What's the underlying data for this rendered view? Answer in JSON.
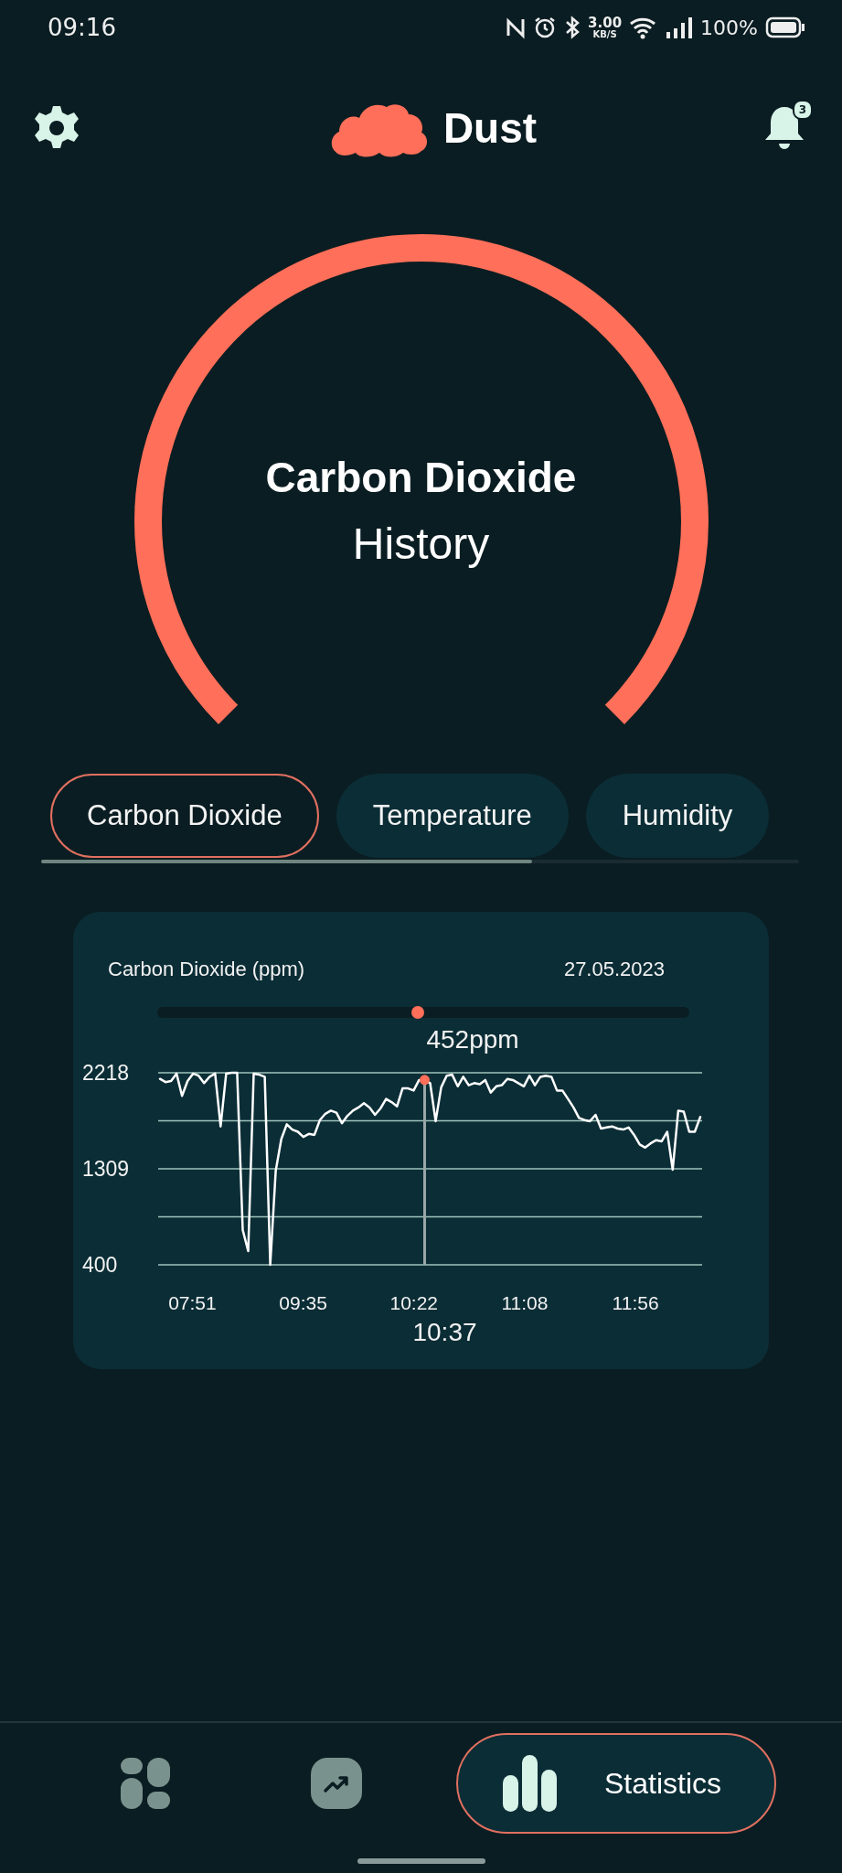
{
  "status_bar": {
    "time": "09:16",
    "net_speed": "3.00",
    "net_unit": "KB/S",
    "battery": "100%"
  },
  "header": {
    "title": "Dust",
    "notification_count": "3"
  },
  "gauge": {
    "title": "Carbon Dioxide",
    "subtitle": "History"
  },
  "tabs": [
    {
      "label": "Carbon Dioxide",
      "selected": true
    },
    {
      "label": "Temperature",
      "selected": false
    },
    {
      "label": "Humidity",
      "selected": false
    }
  ],
  "chart_card": {
    "title": "Carbon Dioxide (ppm)",
    "date": "27.05.2023",
    "scrubber": {
      "level": 0.49
    },
    "reading": "452ppm",
    "selected_time": "10:37",
    "x_labels": [
      "07:51",
      "09:35",
      "10:22",
      "11:08",
      "11:56"
    ],
    "chart_data": {
      "type": "line",
      "ylim": [
        400,
        2218
      ],
      "yticks": [
        400,
        1309,
        2218
      ],
      "series": [
        {
          "color": "#ffffff",
          "values": [
            2160,
            2130,
            2140,
            2210,
            2000,
            2140,
            2210,
            2190,
            2120,
            2180,
            2210,
            1710,
            2210,
            2218,
            2218,
            730,
            530,
            2210,
            2200,
            2180,
            400,
            1290,
            1590,
            1730,
            1680,
            1660,
            1610,
            1640,
            1630,
            1770,
            1830,
            1860,
            1840,
            1740,
            1810,
            1860,
            1890,
            1930,
            1890,
            1820,
            1880,
            1970,
            1940,
            1900,
            2070,
            2070,
            2050,
            2150,
            2150,
            2120,
            1760,
            2080,
            2190,
            2200,
            2090,
            2180,
            2100,
            2120,
            2110,
            2150,
            2030,
            2090,
            2100,
            2160,
            2150,
            2120,
            2090,
            2190,
            2100,
            2180,
            2190,
            2180,
            2050,
            2050,
            1970,
            1890,
            1790,
            1770,
            1760,
            1820,
            1690,
            1700,
            1710,
            1690,
            1680,
            1700,
            1630,
            1540,
            1510,
            1550,
            1580,
            1570,
            1660,
            1300,
            1860,
            1850,
            1660,
            1660,
            1800
          ]
        }
      ]
    }
  },
  "bottom_nav": [
    {
      "selected": false
    },
    {
      "selected": false
    },
    {
      "label": "Statistics",
      "selected": true
    }
  ]
}
